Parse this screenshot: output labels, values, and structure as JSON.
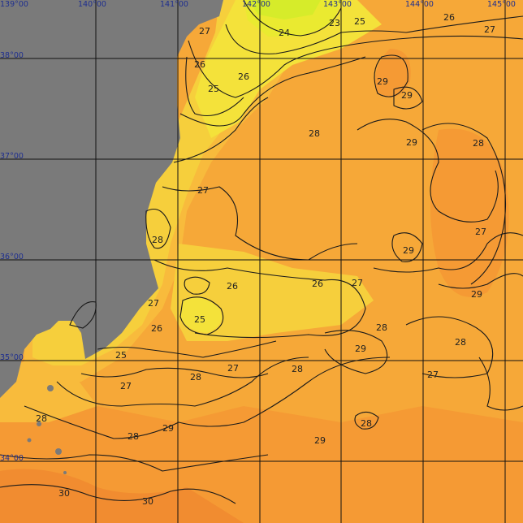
{
  "map": {
    "type": "sea-surface-temperature",
    "longitude_labels": [
      "139°00",
      "140°00",
      "141°00",
      "142°00",
      "143°00",
      "144°00",
      "145°00"
    ],
    "latitude_labels": [
      "38°00",
      "37°00",
      "36°00",
      "35°00",
      "34°00"
    ],
    "isotherm_labels": [
      "23",
      "24",
      "25",
      "25",
      "25",
      "25",
      "26",
      "26",
      "26",
      "26",
      "26",
      "26",
      "27",
      "27",
      "27",
      "27",
      "27",
      "27",
      "27",
      "27",
      "27",
      "28",
      "28",
      "28",
      "28",
      "28",
      "28",
      "28",
      "28",
      "28",
      "28",
      "29",
      "29",
      "29",
      "29",
      "29",
      "29",
      "29",
      "29",
      "30",
      "30"
    ],
    "colors": {
      "land": "#7a7a7a",
      "sst_23": "#d6ec2a",
      "sst_24": "#eaea30",
      "sst_25": "#f4e23a",
      "sst_26": "#f6cf3c",
      "sst_27": "#f8bb3c",
      "sst_28": "#f6a838",
      "sst_29": "#f59a34",
      "sst_30": "#f18c30",
      "grid": "#111111",
      "coordinate_text": "#1f2f8f"
    }
  }
}
